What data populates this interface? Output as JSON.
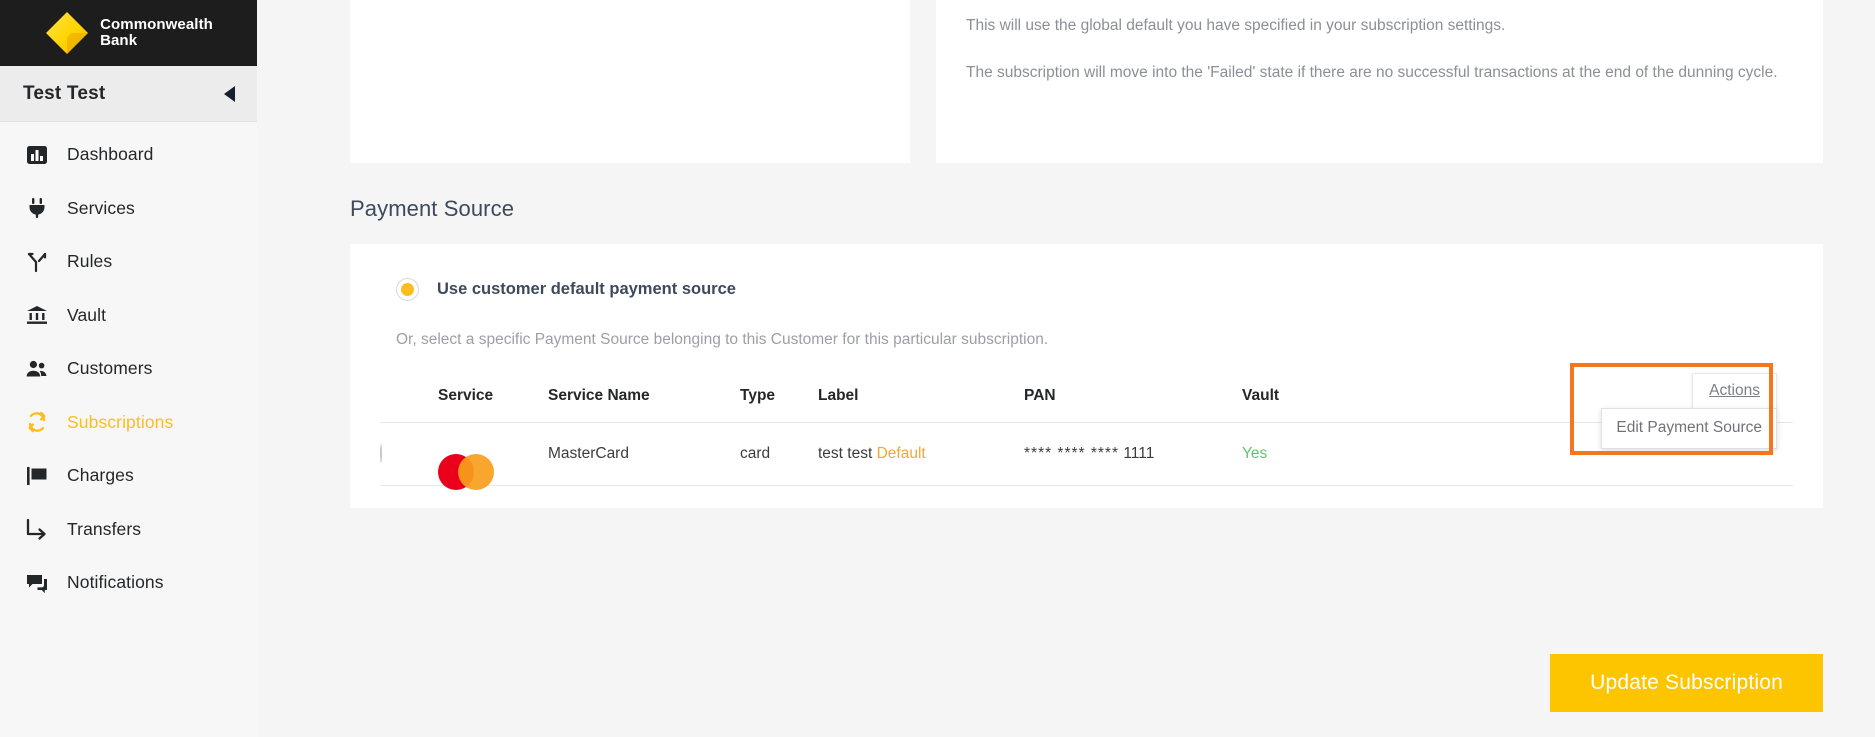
{
  "brand": {
    "logo_line1": "Commonwealth",
    "logo_line2": "Bank",
    "logo_icon": "cba-diamond-logo",
    "accent_yellow": "#fcbd1e",
    "logo_bar_bg": "#1d1d1d"
  },
  "sidebar": {
    "account_name": "Test Test",
    "collapse_icon": "collapse-caret-left-icon",
    "items": [
      {
        "label": "Dashboard",
        "icon": "bar-chart-icon",
        "active": false
      },
      {
        "label": "Services",
        "icon": "plug-icon",
        "active": false
      },
      {
        "label": "Rules",
        "icon": "branch-fork-icon",
        "active": false
      },
      {
        "label": "Vault",
        "icon": "bank-building-icon",
        "active": false
      },
      {
        "label": "Customers",
        "icon": "people-icon",
        "active": false
      },
      {
        "label": "Subscriptions",
        "icon": "refresh-cycle-icon",
        "active": true
      },
      {
        "label": "Charges",
        "icon": "flag-icon",
        "active": false
      },
      {
        "label": "Transfers",
        "icon": "arrow-turn-right-icon",
        "active": false
      },
      {
        "label": "Notifications",
        "icon": "chat-bubbles-icon",
        "active": false
      }
    ]
  },
  "notes": {
    "paragraph_1": "This will use the global default you have specified in your subscription settings.",
    "paragraph_2": "The subscription will move into the 'Failed' state if there are no successful transactions at the end of the dunning cycle."
  },
  "payment_source": {
    "section_title": "Payment Source",
    "default_radio_label": "Use customer default payment source",
    "default_radio_selected": true,
    "helper_text": "Or, select a specific Payment Source belonging to this Customer for this particular subscription.",
    "columns": [
      "",
      "Service",
      "Service Name",
      "Type",
      "Label",
      "PAN",
      "Vault",
      ""
    ],
    "rows": [
      {
        "selected": false,
        "service_icon": "mastercard-logo",
        "service_name": "MasterCard",
        "type": "card",
        "label": "test test",
        "label_badge": "Default",
        "pan_mask": "**** **** ****",
        "pan_last4": "1111",
        "vault": "Yes",
        "actions_label": "Actions"
      }
    ],
    "actions_menu": {
      "items": [
        "Edit Payment Source"
      ]
    },
    "highlight_color": "#f4761f"
  },
  "footer": {
    "primary_button": "Update Subscription",
    "primary_button_color": "#fcc500"
  }
}
